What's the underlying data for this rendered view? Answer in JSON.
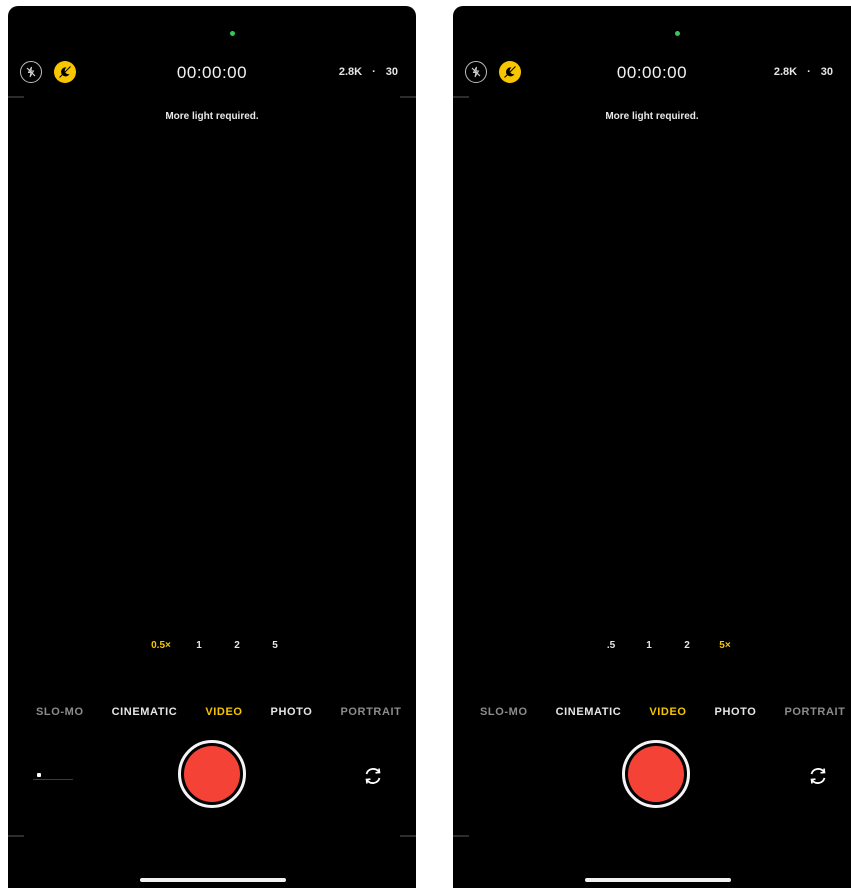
{
  "screens": [
    {
      "timer": "00:00:00",
      "resolution": "2.8K",
      "separator": "·",
      "fps": "30",
      "light_message": "More light required.",
      "zoom_options": [
        {
          "label": "0.5×",
          "active": true
        },
        {
          "label": "1",
          "active": false
        },
        {
          "label": "2",
          "active": false
        },
        {
          "label": "5",
          "active": false
        }
      ],
      "modes": [
        {
          "label": "SLO-MO",
          "state": "faded"
        },
        {
          "label": "CINEMATIC",
          "state": "normal"
        },
        {
          "label": "VIDEO",
          "state": "active"
        },
        {
          "label": "PHOTO",
          "state": "normal"
        },
        {
          "label": "PORTRAIT",
          "state": "faded"
        }
      ]
    },
    {
      "timer": "00:00:00",
      "resolution": "2.8K",
      "separator": "·",
      "fps": "30",
      "light_message": "More light required.",
      "zoom_options": [
        {
          "label": ".5",
          "active": false
        },
        {
          "label": "1",
          "active": false
        },
        {
          "label": "2",
          "active": false
        },
        {
          "label": "5×",
          "active": true
        }
      ],
      "modes": [
        {
          "label": "SLO-MO",
          "state": "faded"
        },
        {
          "label": "CINEMATIC",
          "state": "normal"
        },
        {
          "label": "VIDEO",
          "state": "active"
        },
        {
          "label": "PHOTO",
          "state": "normal"
        },
        {
          "label": "PORTRAIT",
          "state": "faded"
        }
      ]
    }
  ],
  "icons": {
    "flash": "flash-off-icon",
    "night": "night-mode-icon",
    "flip": "camera-flip-icon",
    "shutter": "record-button"
  },
  "colors": {
    "accent": "#f7c600",
    "record": "#f44336",
    "indicator": "#34c759"
  }
}
